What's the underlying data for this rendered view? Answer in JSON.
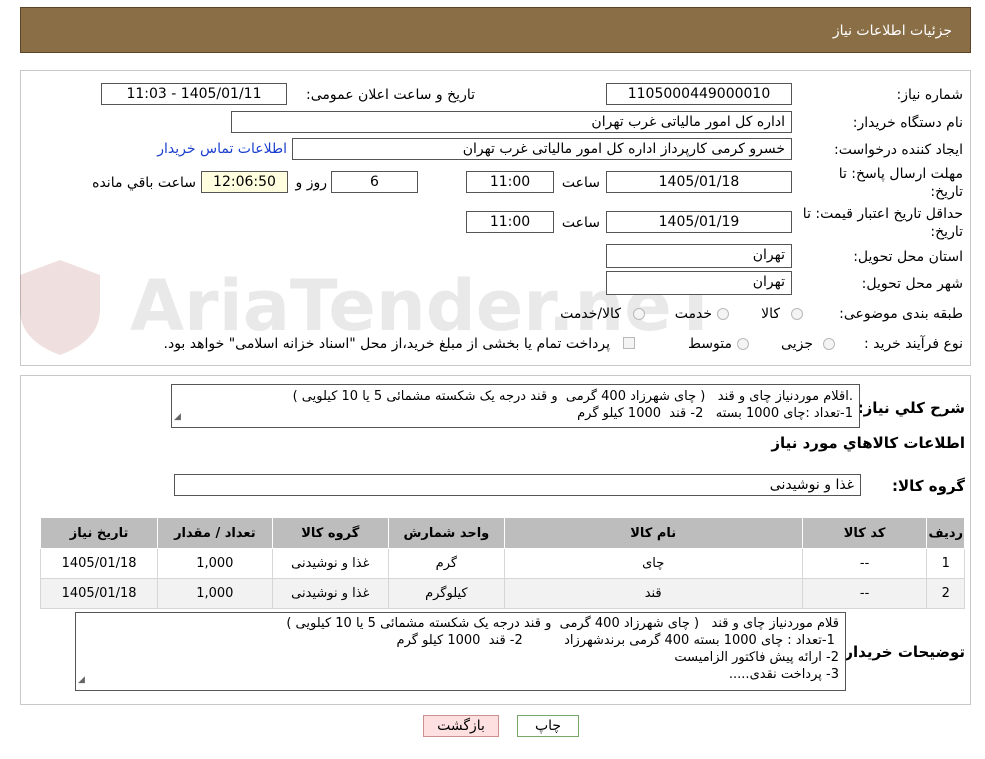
{
  "header": {
    "title": "جزئیات اطلاعات نیاز"
  },
  "watermark": {
    "text": "AriaTender.neT"
  },
  "form": {
    "need_number_label": "شماره نیاز:",
    "need_number": "1105000449000010",
    "announce_label": "تاریخ و ساعت اعلان عمومی:",
    "announce_value": "1405/01/11 - 11:03",
    "buyer_org_label": "نام دستگاه خریدار:",
    "buyer_org": "اداره کل امور مالیاتی غرب تهران",
    "creator_label": "ایجاد کننده درخواست:",
    "creator": "خسرو کرمی کارپرداز اداره کل امور مالیاتی غرب تهران",
    "contact_link": "اطلاعات تماس خریدار",
    "deadline_label_1": "مهلت ارسال پاسخ: تا",
    "deadline_label_2": "تاریخ:",
    "deadline_date": "1405/01/18",
    "time_label": "ساعت",
    "deadline_time": "11:00",
    "days_value": "6",
    "days_label": "روز و",
    "remaining_time": "12:06:50",
    "remaining_label": "ساعت باقي مانده",
    "validity_label_1": "حداقل تاریخ اعتبار قیمت: تا",
    "validity_label_2": "تاریخ:",
    "validity_date": "1405/01/19",
    "validity_time": "11:00",
    "province_label": "استان محل تحویل:",
    "province": "تهران",
    "city_label": "شهر محل تحویل:",
    "city": "تهران",
    "category_label": "طبقه بندی موضوعی:",
    "category_options": [
      "کالا",
      "خدمت",
      "کالا/خدمت"
    ],
    "process_label": "نوع فرآیند خرید :",
    "process_options": [
      "جزیی",
      "متوسط"
    ],
    "treasury_note": "پرداخت تمام یا بخشی از مبلغ خرید،از محل \"اسناد خزانه اسلامی\" خواهد بود."
  },
  "summary": {
    "label": "شرح کلي نياز:",
    "lines": [
      ".اقلام موردنیاز چای و قند   ( چای شهرزاد 400 گرمی  و قند درجه یک شکسته مشمائی 5 یا 10 کیلویی )",
      "1-تعداد :چای 1000 بسته   2- قند  1000 کیلو گرم"
    ]
  },
  "goods": {
    "section_title": "اطلاعات کالاهاي مورد نياز",
    "group_label": "گروه کالا:",
    "group_value": "غذا و نوشیدنی"
  },
  "table": {
    "headers": [
      "ردیف",
      "کد کالا",
      "نام کالا",
      "واحد شمارش",
      "گروه کالا",
      "تعداد / مقدار",
      "تاریخ نیاز"
    ],
    "rows": [
      [
        "1",
        "--",
        "چای",
        "گرم",
        "غذا و نوشیدنی",
        "1,000",
        "1405/01/18"
      ],
      [
        "2",
        "--",
        "قند",
        "کیلوگرم",
        "غذا و نوشیدنی",
        "1,000",
        "1405/01/18"
      ]
    ]
  },
  "buyer_notes": {
    "label": "توضیحات خریدار:",
    "lines": [
      "قلام موردنیاز چای و قند   ( چای شهرزاد 400 گرمی  و قند درجه یک شکسته مشمائی 5 یا 10 کیلویی )",
      " 1-تعداد : چای 1000 بسته 400 گرمی برندشهرزاد          2- قند  1000 کیلو گرم",
      "2- ارائه پیش فاکتور الزامیست",
      "3- پرداخت نقدی....."
    ]
  },
  "buttons": {
    "print": "چاپ",
    "back": "بازگشت"
  }
}
